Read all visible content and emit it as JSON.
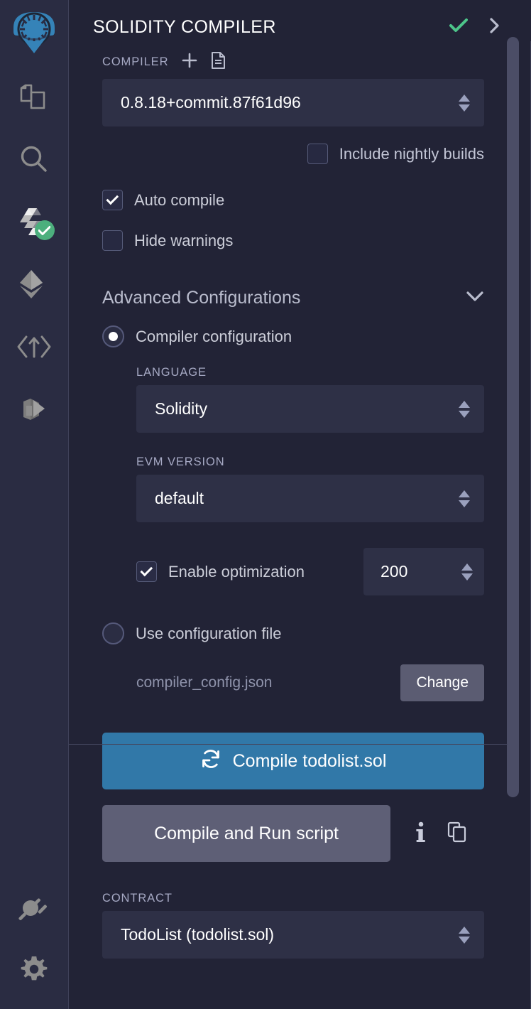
{
  "window": {
    "background": "#222336",
    "accent_blue": "#3178a8",
    "success_green": "#4caf7d"
  },
  "iconbar": {
    "items": [
      {
        "name": "remix-logo-icon",
        "label": "Remix"
      },
      {
        "name": "file-explorer-icon",
        "label": "File explorer"
      },
      {
        "name": "search-icon",
        "label": "Search in files"
      },
      {
        "name": "solidity-compiler-icon",
        "label": "Solidity compiler",
        "badge": "check"
      },
      {
        "name": "deploy-run-icon",
        "label": "Deploy & run transactions"
      },
      {
        "name": "debugger-icon",
        "label": "Debugger"
      },
      {
        "name": "git-icon",
        "label": "Git"
      }
    ],
    "bottom_items": [
      {
        "name": "plugin-manager-icon",
        "label": "Plugin manager"
      },
      {
        "name": "settings-gear-icon",
        "label": "Settings"
      }
    ]
  },
  "header": {
    "title": "SOLIDITY COMPILER",
    "status_icon": "check-icon",
    "expand_icon": "chevron-right-icon"
  },
  "compiler": {
    "section_label": "COMPILER",
    "add_icon": "plus-icon",
    "file_icon": "document-icon",
    "version": "0.8.18+commit.87f61d96",
    "nightly_builds_label": "Include nightly builds",
    "nightly_builds_checked": false,
    "auto_compile_label": "Auto compile",
    "auto_compile_checked": true,
    "hide_warnings_label": "Hide warnings",
    "hide_warnings_checked": false
  },
  "advanced": {
    "title": "Advanced Configurations",
    "collapse_icon": "chevron-down-icon",
    "compiler_configuration_label": "Compiler configuration",
    "compiler_configuration_selected": true,
    "language_label": "LANGUAGE",
    "language_value": "Solidity",
    "evm_version_label": "EVM VERSION",
    "evm_version_value": "default",
    "enable_optimization_label": "Enable optimization",
    "enable_optimization_checked": true,
    "runs_value": "200",
    "use_config_file_label": "Use configuration file",
    "use_config_file_selected": false,
    "config_file_name": "compiler_config.json",
    "change_button_label": "Change"
  },
  "actions": {
    "compile_icon": "refresh-icon",
    "compile_label": "Compile todolist.sol",
    "run_script_label": "Compile and Run script",
    "info_icon": "info-icon",
    "copy_icon": "copy-icon"
  },
  "contract": {
    "label": "CONTRACT",
    "value": "TodoList (todolist.sol)"
  }
}
